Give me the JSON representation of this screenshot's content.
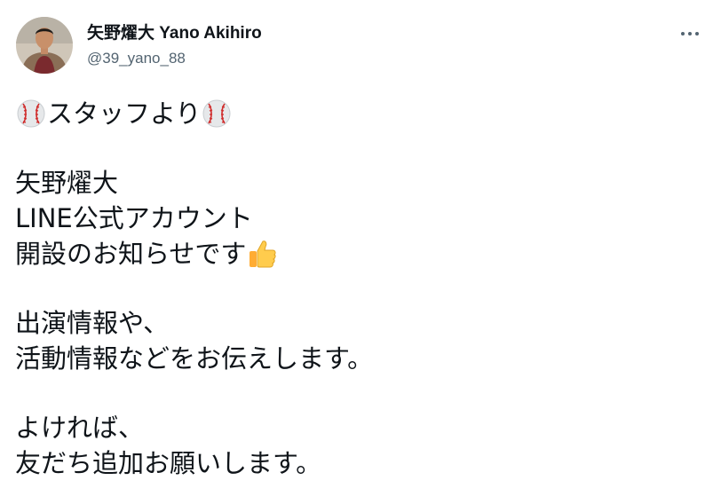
{
  "tweet": {
    "author": {
      "display_name": "矢野燿大 Yano Akihiro",
      "handle": "@39_yano_88"
    },
    "more_icon": "more-horizontal-icon",
    "lines": {
      "l1": "スタッフより",
      "l2": "矢野燿大",
      "l3": "LINE公式アカウント",
      "l4": "開設のお知らせです",
      "l5": "出演情報や、",
      "l6": "活動情報などをお伝えします。",
      "l7": "よければ、",
      "l8": "友だち追加お願いします。"
    },
    "emojis": {
      "baseball": "baseball-emoji",
      "thumbs_up": "thumbs-up-emoji"
    }
  },
  "colors": {
    "text": "#0f1419",
    "secondary": "#536471",
    "background": "#ffffff"
  }
}
